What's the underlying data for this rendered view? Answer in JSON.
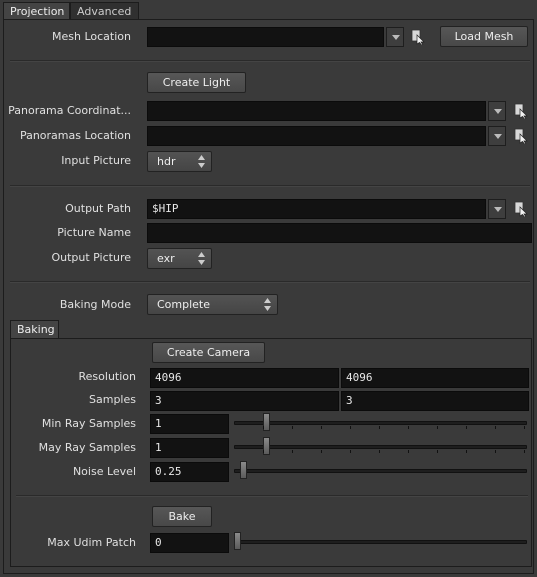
{
  "tabs": {
    "projection": "Projection",
    "advanced": "Advanced"
  },
  "mesh": {
    "label": "Mesh Location",
    "value": "",
    "load_button": "Load Mesh"
  },
  "create_light_button": "Create Light",
  "panorama_coordinates": {
    "label": "Panorama Coordinat...",
    "value": ""
  },
  "panoramas_location": {
    "label": "Panoramas Location",
    "value": ""
  },
  "input_picture": {
    "label": "Input Picture",
    "value": "hdr"
  },
  "output_path": {
    "label": "Output Path",
    "value": "$HIP"
  },
  "picture_name": {
    "label": "Picture Name",
    "value": ""
  },
  "output_picture": {
    "label": "Output Picture",
    "value": "exr"
  },
  "baking_mode": {
    "label": "Baking Mode",
    "value": "Complete"
  },
  "baking_tab": "Baking",
  "create_camera_button": "Create Camera",
  "resolution": {
    "label": "Resolution",
    "x": "4096",
    "y": "4096"
  },
  "samples": {
    "label": "Samples",
    "x": "3",
    "y": "3"
  },
  "min_ray_samples": {
    "label": "Min Ray Samples",
    "value": "1",
    "slider_fraction": 0.1
  },
  "max_ray_samples": {
    "label": "May Ray Samples",
    "value": "1",
    "slider_fraction": 0.1
  },
  "noise_level": {
    "label": "Noise Level",
    "value": "0.25",
    "slider_fraction": 0.02
  },
  "bake_button": "Bake",
  "max_udim_patch": {
    "label": "Max Udim Patch",
    "value": "0",
    "slider_fraction": 0.0
  }
}
